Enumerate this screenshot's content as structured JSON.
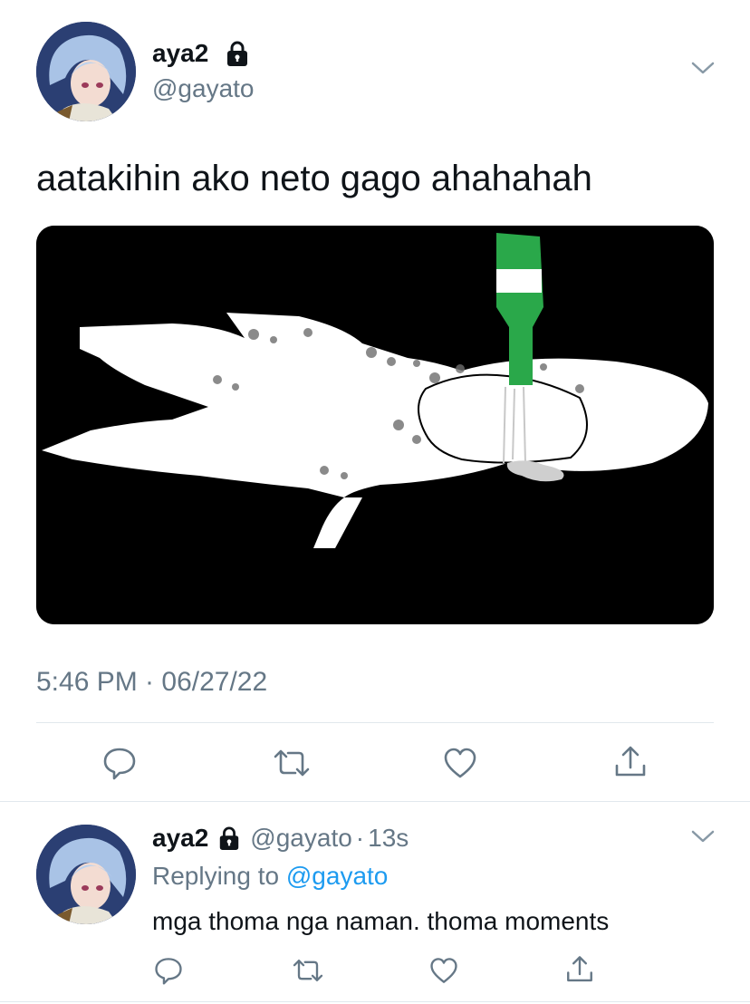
{
  "tweet": {
    "display_name": "aya2",
    "handle": "@gayato",
    "text": "aatakihin ako neto gago ahahahah",
    "timestamp": "5:46 PM · 06/27/22",
    "avatar_icon": "avatar-anime-character",
    "lock_icon": "lock-icon",
    "menu_icon": "chevron-down-icon"
  },
  "actions": [
    "reply-icon",
    "retweet-icon",
    "like-icon",
    "share-icon"
  ],
  "reply": {
    "display_name": "aya2",
    "handle": "@gayato",
    "separator": "·",
    "time": "13s",
    "replying_label": "Replying to",
    "replying_to": "@gayato",
    "text": "mga thoma nga naman. thoma moments"
  },
  "colors": {
    "accent": "#1d9bf0",
    "muted": "#657786",
    "text": "#0f1419",
    "divider": "#e1e8ed",
    "bottle_green": "#2aa84a"
  }
}
